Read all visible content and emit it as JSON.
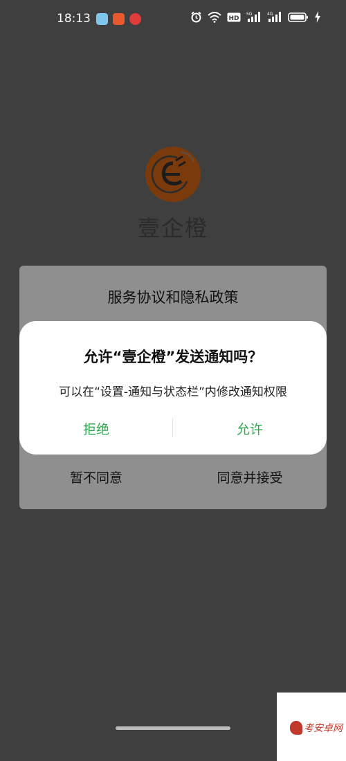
{
  "status_bar": {
    "time": "18:13",
    "app_icons": [
      "weather-icon",
      "news-icon",
      "chat-icon"
    ],
    "right_icons": [
      "alarm-icon",
      "wifi-icon",
      "hd-icon",
      "signal-5g-icon",
      "signal-4g-icon",
      "battery-icon",
      "charging-icon"
    ],
    "hd_label": "HD",
    "net1_label": "5G",
    "net2_label": "4G"
  },
  "app": {
    "name": "壹企橙",
    "logo_color": "#7a3a0c"
  },
  "agreement_dialog": {
    "title": "服务协议和隐私政策",
    "decline_label": "暂不同意",
    "accept_label": "同意并接受"
  },
  "permission_dialog": {
    "title": "允许“壹企橙”发送通知吗？",
    "message": "可以在“设置-通知与状态栏”内修改通知权限",
    "deny_label": "拒绝",
    "allow_label": "允许",
    "accent_color": "#2ea84f"
  },
  "watermark": {
    "text": "考安卓网"
  }
}
